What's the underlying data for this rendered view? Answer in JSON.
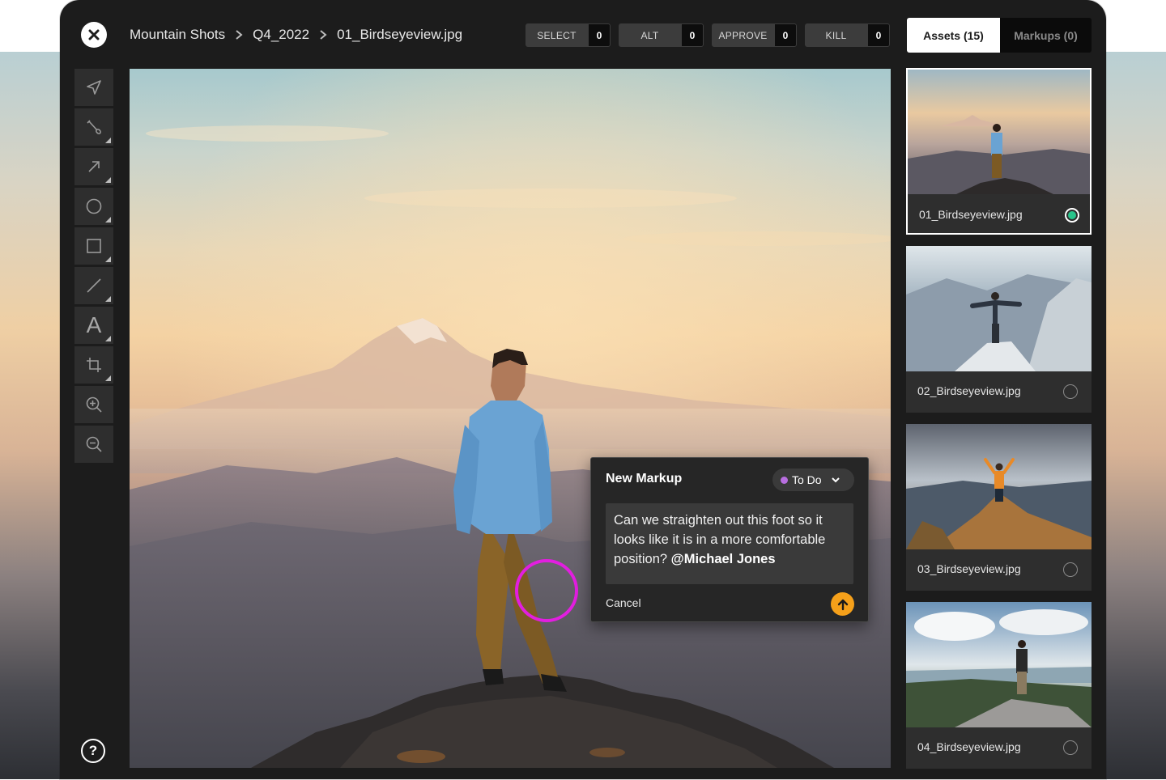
{
  "breadcrumb": {
    "items": [
      "Mountain Shots",
      "Q4_2022",
      "01_Birdseyeview.jpg"
    ]
  },
  "counters": [
    {
      "label": "SELECT",
      "value": "0"
    },
    {
      "label": "ALT",
      "value": "0"
    },
    {
      "label": "APPROVE",
      "value": "0"
    },
    {
      "label": "KILL",
      "value": "0"
    }
  ],
  "tabs": {
    "assets": "Assets (15)",
    "markups": "Markups (0)"
  },
  "toolbar": {
    "tools": [
      "send-icon",
      "brush-icon",
      "arrow-icon",
      "circle-icon",
      "square-icon",
      "line-icon",
      "text-icon",
      "crop-icon",
      "zoom-in-icon",
      "zoom-out-icon"
    ],
    "text_tool_glyph": "A"
  },
  "help": {
    "glyph": "?"
  },
  "markup": {
    "title": "New Markup",
    "status": "To Do",
    "status_color": "#b86ee0",
    "comment_text": "Can we straighten out this foot so it looks like it is in a more comfortable position? ",
    "mention": "@Michael Jones",
    "cancel_label": "Cancel",
    "send_color": "#f5a01a",
    "markup_circle_color": "#e21ee0"
  },
  "assets": [
    {
      "name": "01_Birdseyeview.jpg",
      "selected": true
    },
    {
      "name": "02_Birdseyeview.jpg",
      "selected": false
    },
    {
      "name": "03_Birdseyeview.jpg",
      "selected": false
    },
    {
      "name": "04_Birdseyeview.jpg",
      "selected": false
    }
  ],
  "colors": {
    "app_bg": "#1c1c1c",
    "selected_indicator": "#29c48b"
  }
}
